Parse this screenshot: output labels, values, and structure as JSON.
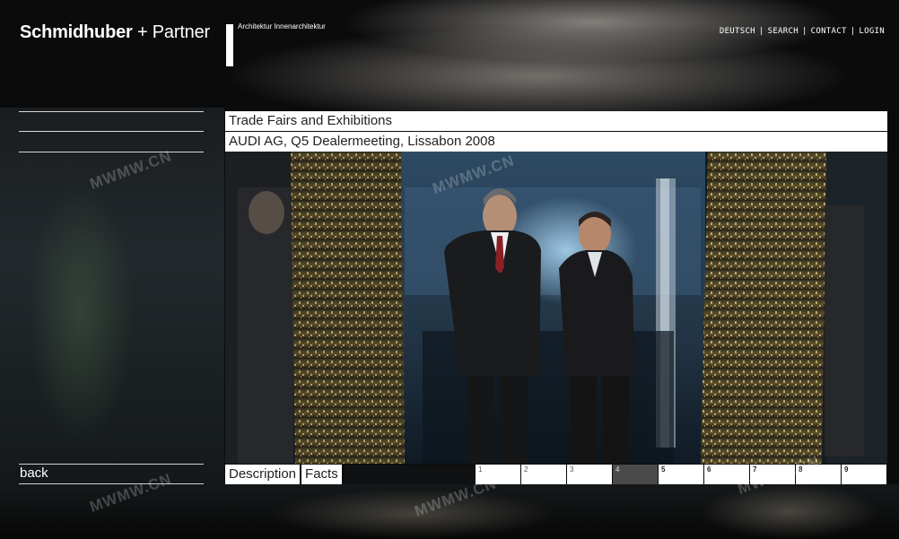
{
  "brand": {
    "name_bold": "Schmidhuber",
    "name_plus": "+",
    "name_regular": "Partner",
    "tagline": "Architektur  Innenarchitektur"
  },
  "topnav": [
    {
      "label": "DEUTSCH"
    },
    {
      "label": "SEARCH"
    },
    {
      "label": "CONTACT"
    },
    {
      "label": "LOGIN"
    }
  ],
  "topnav_separator": "|",
  "content": {
    "category": "Trade Fairs and Exhibitions",
    "project": "AUDI AG,  Q5 Dealermeeting, Lissabon 2008"
  },
  "back_label": "back",
  "tabs": [
    {
      "label": "Description"
    },
    {
      "label": "Facts"
    }
  ],
  "pages": [
    "1",
    "2",
    "3",
    "4",
    "5",
    "6",
    "7",
    "8",
    "9"
  ],
  "active_page": "4",
  "watermarks": [
    "MWMW.CN",
    "MWMW.CN",
    "MWMW.CN",
    "MWMW.CN",
    "MWMW.CN"
  ],
  "colors": {
    "bar_background": "#ffffff",
    "active_page": "#4a4a4a",
    "page_background": "#0b0b0c"
  }
}
